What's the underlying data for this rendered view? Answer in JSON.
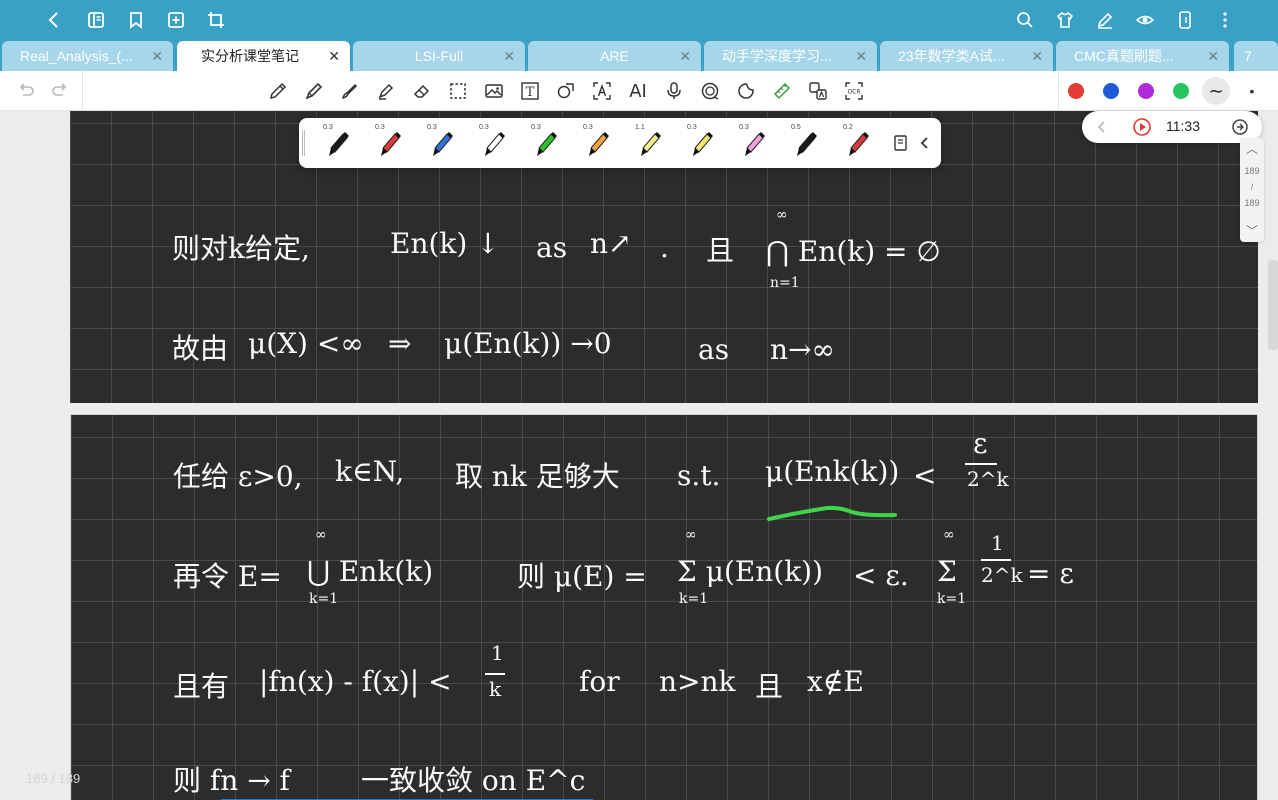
{
  "app": {
    "topbar_icons": [
      "back-chevron-icon",
      "outline-icon",
      "bookmark-icon",
      "add-page-icon",
      "crop-icon",
      "search-icon",
      "shirt-icon",
      "pen-settings-icon",
      "eye-icon",
      "phone-icon",
      "more-vertical-icon"
    ]
  },
  "tabs": [
    {
      "label": "Real_Analysis_(...",
      "active": false
    },
    {
      "label": "实分析课堂笔记",
      "active": true
    },
    {
      "label": "LSI-Full",
      "active": false
    },
    {
      "label": "ARE",
      "active": false
    },
    {
      "label": "动手学深度学习...",
      "active": false
    },
    {
      "label": "23年数学类A试...",
      "active": false
    },
    {
      "label": "CMC真题刷题...",
      "active": false
    },
    {
      "label": "7",
      "active": false
    }
  ],
  "toolbar": {
    "tools": [
      "pencil-icon",
      "pen-icon",
      "brush-icon",
      "highlighter-icon",
      "eraser-icon",
      "lasso-select-icon",
      "image-icon",
      "text-box-icon",
      "shape-icon",
      "ocr-text-icon",
      "ai-icon",
      "microphone-icon",
      "sticker-icon",
      "sticky-note-icon",
      "ruler-icon",
      "translate-icon",
      "ocr-scan-icon"
    ],
    "ai_label": "AI",
    "text_label": "T",
    "ocr_label": "OCR",
    "colors": [
      "#e53935",
      "#1e5bd8",
      "#b02ad9",
      "#22c55e"
    ]
  },
  "pen_popup": {
    "pens": [
      {
        "size": "0.3",
        "color": "#1a1a1a"
      },
      {
        "size": "0.3",
        "color": "#d93a3a"
      },
      {
        "size": "0.3",
        "color": "#2f6fd8"
      },
      {
        "size": "0.3",
        "color": "#ffffff"
      },
      {
        "size": "0.3",
        "color": "#2cc12c"
      },
      {
        "size": "0.3",
        "color": "#f2a43c"
      },
      {
        "size": "1.1",
        "color": "#f4ef86"
      },
      {
        "size": "0.3",
        "color": "#f3e56b"
      },
      {
        "size": "0.3",
        "color": "#f0a3e0"
      },
      {
        "size": "0.5",
        "color": "#1a1a1a"
      },
      {
        "size": "0.2",
        "color": "#d93a3a"
      }
    ]
  },
  "video_widget": {
    "time": "11:33"
  },
  "pager": {
    "current": "189",
    "slash": "/",
    "total": "189",
    "ghost_label": "189 / 189"
  },
  "notes": {
    "page1": {
      "line1": {
        "a": "则对k给定,",
        "b": "En(k) ↓",
        "c": "as",
        "d": "n↗",
        "e": ".",
        "f": "且",
        "g": "⋂ En(k) = ∅",
        "g_top": "∞",
        "g_bot": "n=1"
      },
      "line2": {
        "a": "故由",
        "b": "μ(X) <∞",
        "c": "⇒",
        "d": "μ(En(k)) →0",
        "e": "as",
        "f": "n→∞"
      }
    },
    "page2": {
      "line1": {
        "a": "任给 ε>0,",
        "b": "k∈N,",
        "c": "取 nk 足够大",
        "d": "s.t.",
        "e": "μ(Enk(k))",
        "f": "<",
        "g_num": "ε",
        "g_den": "2^k"
      },
      "line2": {
        "a": "再令 E=",
        "b": "⋃ Enk(k)",
        "b_top": "∞",
        "b_bot": "k=1",
        "c": "则 μ(E) =",
        "d": "Σ μ(En(k))",
        "d_top": "∞",
        "d_bot": "k=1",
        "e": "< ε.",
        "f": "Σ",
        "f_top": "∞",
        "f_bot": "k=1",
        "f_num": "1",
        "f_den": "2^k",
        "g": "= ε"
      },
      "line3": {
        "a": "且有",
        "b": "|fn(x) - f(x)| <",
        "b_num": "1",
        "b_den": "k",
        "c": "for",
        "d": "n>nk",
        "e": "且",
        "f": "x∉E"
      },
      "line4": {
        "a": "则 fn → f",
        "b": "一致收敛 on E^c"
      }
    }
  }
}
